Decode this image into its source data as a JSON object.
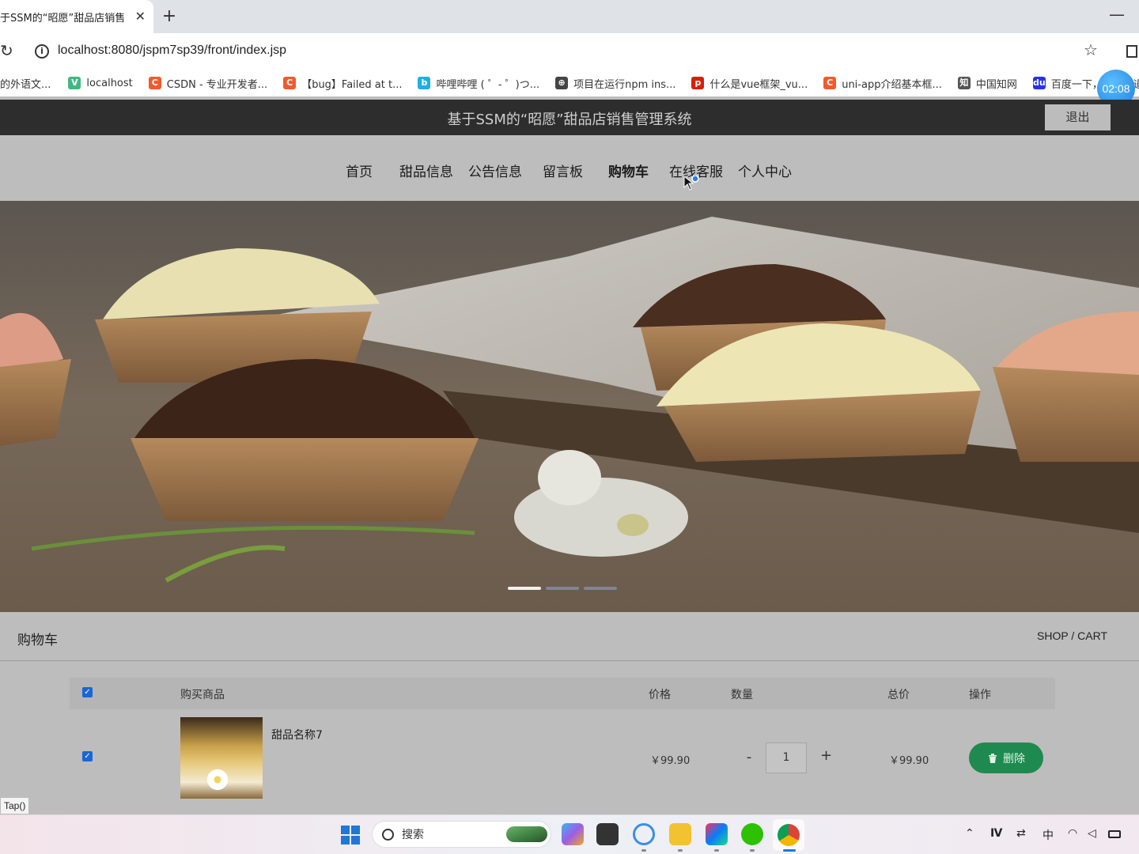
{
  "browser": {
    "tab_title": "于SSM的“昭愿”甜品店销售管",
    "tab_close": "✕",
    "new_tab": "+",
    "window_min": "—",
    "url": "localhost:8080/jspm7sp39/front/index.jsp",
    "bookmarks": [
      {
        "label": "的外语文...",
        "icon": "",
        "color": "#ffffff"
      },
      {
        "label": "localhost",
        "icon": "V",
        "color": "#41b883"
      },
      {
        "label": "CSDN - 专业开发者...",
        "icon": "C",
        "color": "#f25a2c"
      },
      {
        "label": "【bug】Failed at t...",
        "icon": "C",
        "color": "#f25a2c"
      },
      {
        "label": "哔哩哔哩 ( ゜- ゜)つ...",
        "icon": "b",
        "color": "#23ade5"
      },
      {
        "label": "项目在运行npm ins...",
        "icon": "⊕",
        "color": "#444444"
      },
      {
        "label": "什么是vue框架_vu...",
        "icon": "p",
        "color": "#d81e06"
      },
      {
        "label": "uni-app介绍基本框...",
        "icon": "C",
        "color": "#f25a2c"
      },
      {
        "label": "中国知网",
        "icon": "知",
        "color": "#555555"
      },
      {
        "label": "百度一下，你就知道",
        "icon": "du",
        "color": "#2932e1"
      }
    ],
    "timer": "02:08"
  },
  "site": {
    "title": "基于SSM的“昭愿”甜品店销售管理系统",
    "logout": "退出",
    "nav": [
      {
        "label": "首页",
        "active": false
      },
      {
        "label": "甜品信息",
        "active": false
      },
      {
        "label": "公告信息",
        "active": false
      },
      {
        "label": "留言板",
        "active": false
      },
      {
        "label": "购物车",
        "active": true
      },
      {
        "label": "在线客服",
        "active": false
      },
      {
        "label": "个人中心",
        "active": false
      }
    ]
  },
  "banner": {
    "slides": 3,
    "active_slide": 1
  },
  "cart": {
    "title": "购物车",
    "title_en": "SHOP / CART",
    "headers": {
      "product": "购买商品",
      "price": "价格",
      "quantity": "数量",
      "total": "总价",
      "action": "操作"
    },
    "items": [
      {
        "name": "甜品名称7",
        "price": "￥99.90",
        "quantity": "1",
        "total": "￥99.90",
        "delete_label": "删除",
        "checked": true
      }
    ],
    "minus": "-",
    "plus": "+"
  },
  "status_tip": "Tap()",
  "taskbar": {
    "search_placeholder": "搜索",
    "ime": "中"
  }
}
